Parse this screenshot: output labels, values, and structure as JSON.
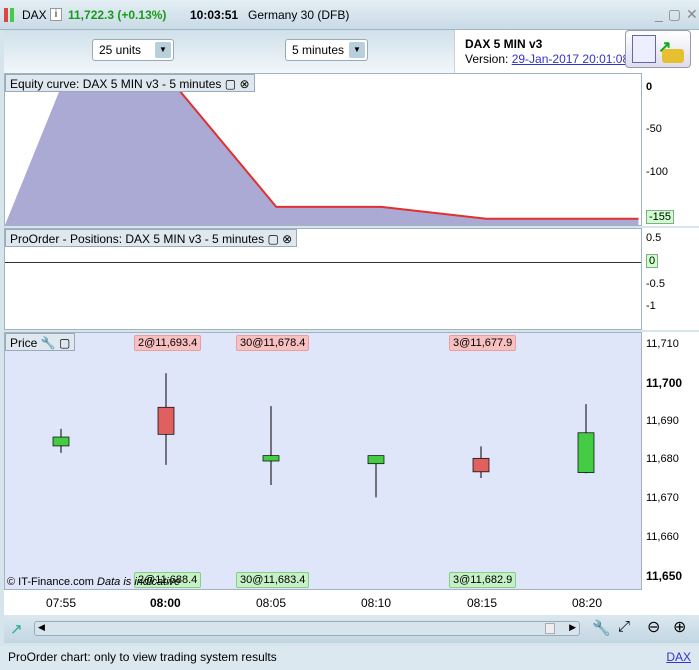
{
  "title": {
    "symbol": "DAX",
    "price": "11,722.3 (+0.13%)",
    "time": "10:03:51",
    "name": "Germany 30 (DFB)"
  },
  "toolbar": {
    "units": "25 units",
    "interval": "5 minutes"
  },
  "system": {
    "name": "DAX 5 MIN v3",
    "version_label": "Version:",
    "version": "29-Jan-2017 20:01:08"
  },
  "equity": {
    "label": "Equity curve: DAX 5 MIN v3 - 5 minutes",
    "ticks": [
      "0",
      "-50",
      "-100"
    ],
    "last": "-155"
  },
  "positions": {
    "label": "ProOrder - Positions: DAX 5 MIN v3 - 5 minutes",
    "ticks": [
      "0.5",
      "-0.5",
      "-1"
    ],
    "last": "0"
  },
  "price": {
    "label": "Price",
    "ticks": [
      "11,710",
      "11,700",
      "11,690",
      "11,680",
      "11,670",
      "11,660",
      "11,650"
    ],
    "orders_top": [
      "2@11,693.4",
      "30@11,678.4",
      "3@11,677.9"
    ],
    "orders_bottom": [
      "2@11,688.4",
      "30@11,683.4",
      "3@11,682.9"
    ],
    "copyright": "© IT-Finance.com",
    "disclaimer": "Data is indicative"
  },
  "xaxis": [
    "07:55",
    "08:00",
    "08:05",
    "08:10",
    "08:15",
    "08:20"
  ],
  "status": {
    "text": "ProOrder chart: only to view trading system results",
    "link": "DAX"
  },
  "colors": {
    "up": "#44cc44",
    "down": "#e06060",
    "equity_fill": "#aaaad4",
    "equity_line": "#e03030"
  },
  "chart_data": {
    "type": "candlestick",
    "x": [
      "07:55",
      "08:00",
      "08:05",
      "08:10",
      "08:15",
      "08:20"
    ],
    "open": [
      11683.9,
      11693.9,
      11680.0,
      11679.3,
      11680.7,
      11677.0
    ],
    "high": [
      11688.3,
      11702.7,
      11694.2,
      11681.4,
      11683.8,
      11694.7
    ],
    "low": [
      11682.1,
      11679.0,
      11673.8,
      11670.6,
      11675.6,
      11676.8
    ],
    "close": [
      11686.2,
      11686.9,
      11681.4,
      11681.4,
      11677.2,
      11687.3
    ],
    "equity": [
      [
        0,
        0
      ],
      [
        1.1,
        0
      ],
      [
        2.05,
        -141
      ],
      [
        3.05,
        -141
      ],
      [
        4.05,
        -155
      ],
      [
        5.5,
        -155
      ]
    ]
  }
}
